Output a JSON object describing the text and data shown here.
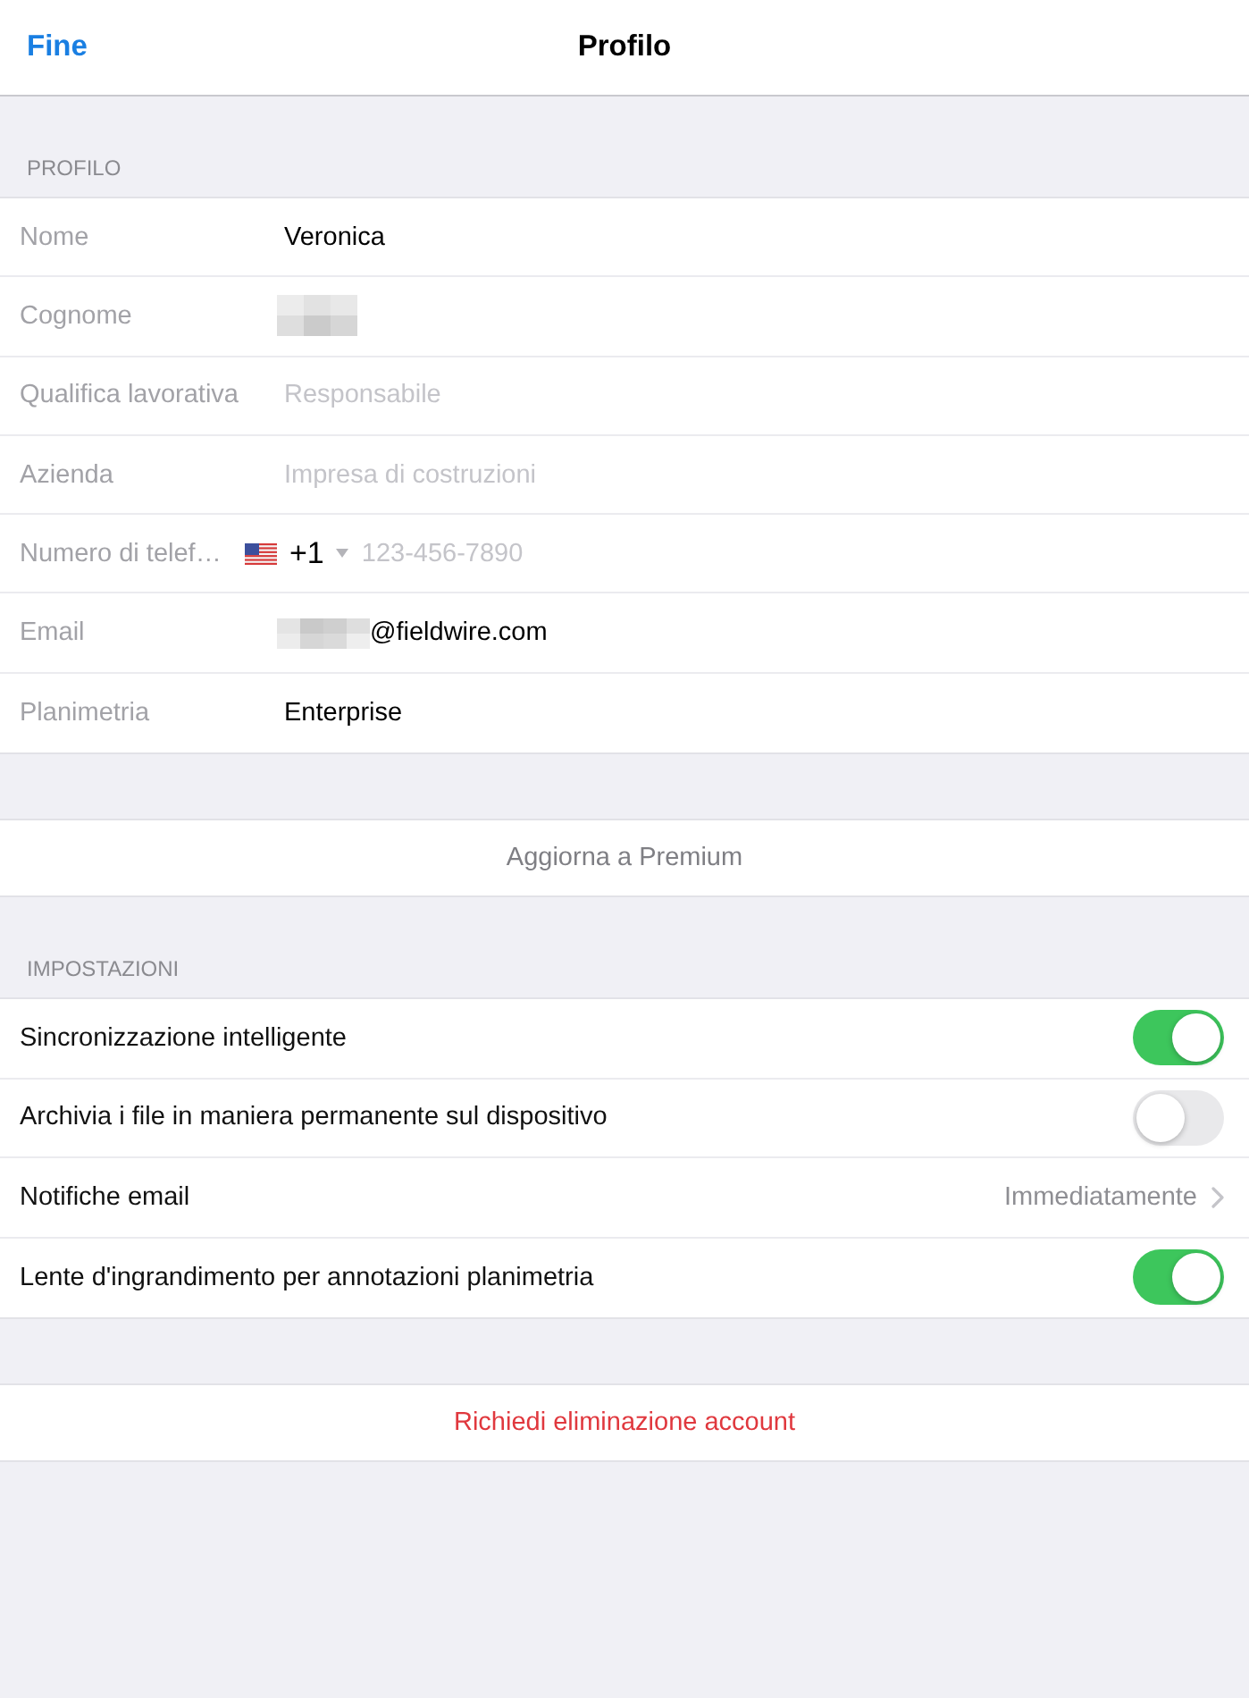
{
  "nav_bar": {
    "done_button": "Fine",
    "title": "Profilo"
  },
  "profile_section": {
    "header": "PROFILO",
    "fields": [
      {
        "kind": "text",
        "label": "Nome",
        "value": "Veronica",
        "redacted": false
      },
      {
        "kind": "text",
        "label": "Cognome",
        "redacted": true
      },
      {
        "kind": "text",
        "label": "Qualifica lavorativa",
        "placeholder": "Responsabile",
        "redacted": false
      },
      {
        "kind": "text",
        "label": "Azienda",
        "placeholder": "Impresa di costruzioni",
        "redacted": false
      },
      {
        "kind": "phone",
        "label": "Numero di telef…",
        "country_code": "+1",
        "placeholder": "123-456-7890"
      },
      {
        "kind": "text",
        "label": "Email",
        "value": "@fieldwire.com",
        "redacted": true
      },
      {
        "kind": "static",
        "label": "Planimetria",
        "value": "Enterprise"
      }
    ]
  },
  "upgrade_button": "Aggiorna a Premium",
  "settings_section": {
    "header": "IMPOSTAZIONI",
    "items": [
      {
        "kind": "toggle",
        "label": "Sincronizzazione intelligente",
        "on": true
      },
      {
        "kind": "toggle",
        "label": "Archivia i file in maniera permanente sul dispositivo",
        "on": false
      },
      {
        "kind": "disclosure",
        "label": "Notifiche email",
        "value": "Immediatamente"
      },
      {
        "kind": "toggle",
        "label": "Lente d'ingrandimento per annotazioni planimetria",
        "on": true
      }
    ]
  },
  "delete_account_button": "Richiedi eliminazione account"
}
